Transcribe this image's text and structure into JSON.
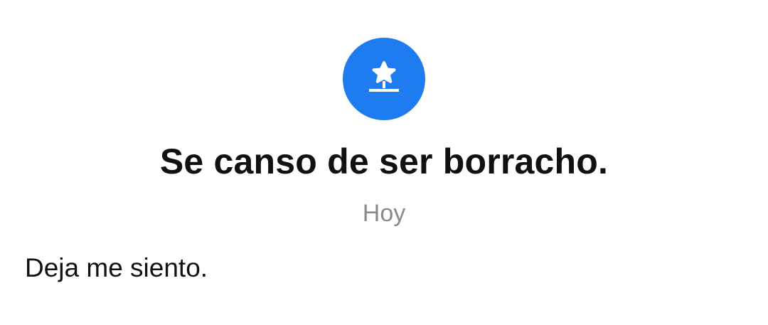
{
  "colors": {
    "accent": "#1f7cf0",
    "title_text": "#111111",
    "secondary_text": "#8a8a8e",
    "background": "#ffffff"
  },
  "event": {
    "icon": "pinned-star-icon",
    "title": "Se canso de ser borracho.",
    "date": "Hoy",
    "message": "Deja me siento."
  }
}
